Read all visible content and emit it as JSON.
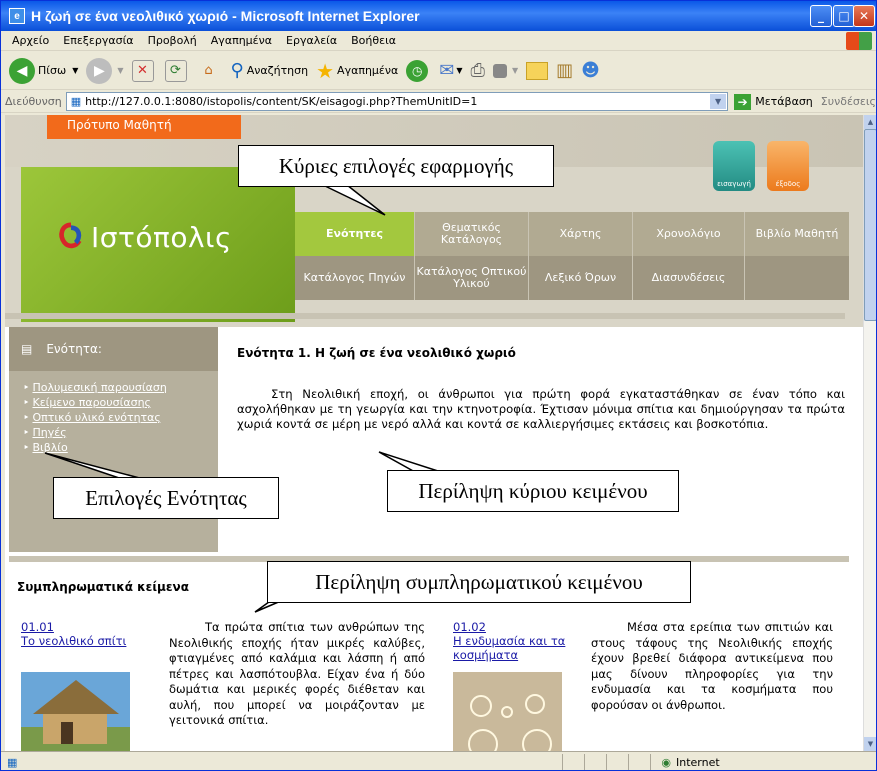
{
  "window": {
    "title": "Η ζωή σε ένα νεολιθικό χωριό - Microsoft Internet Explorer"
  },
  "menu": [
    "Αρχείο",
    "Επεξεργασία",
    "Προβολή",
    "Αγαπημένα",
    "Εργαλεία",
    "Βοήθεια"
  ],
  "toolbar": {
    "back": "Πίσω",
    "search": "Αναζήτηση",
    "favorites": "Αγαπημένα"
  },
  "address": {
    "label": "Διεύθυνση",
    "url": "http://127.0.0.1:8080/istopolis/content/SK/eisagogi.php?ThemUnitID=1",
    "go": "Μετάβαση",
    "links": "Συνδέσεις"
  },
  "site": {
    "model_tab": "Πρότυπο Μαθητή",
    "logo": "Ιστόπολις",
    "icons": [
      {
        "label": "εισαγωγή",
        "color": "#2fa39a"
      },
      {
        "label": "έξοδος",
        "color": "#f08a2a"
      }
    ],
    "nav_row1": [
      "Ενότητες",
      "Θεματικός Κατάλογος",
      "Χάρτης",
      "Χρονολόγιο",
      "Βιβλίο Μαθητή"
    ],
    "nav_row2": [
      "Κατάλογος Πηγών",
      "Κατάλογος Οπτικού Υλικού",
      "Λεξικό Όρων",
      "Διασυνδέσεις"
    ]
  },
  "sidebar": {
    "heading": "Ενότητα:",
    "items": [
      "Πολυμεσική παρουσίαση",
      "Κείμενο παρουσίασης",
      "Οπτικό υλικό ενότητας",
      "Πηγές",
      "Βιβλίο"
    ]
  },
  "main": {
    "title": "Ενότητα 1. Η ζωή σε ένα νεολιθικό χωριό",
    "paragraph": "Στη Νεολιθική εποχή, οι άνθρωποι για πρώτη φορά εγκαταστάθηκαν σε έναν τόπο και ασχολήθηκαν με τη γεωργία και την κτηνοτροφία. Έχτισαν μόνιμα σπίτια και δημιούργησαν τα πρώτα χωριά κοντά σε μέρη με νερό αλλά και κοντά σε καλλιεργήσιμες εκτάσεις και βοσκοτόπια."
  },
  "supplementary": {
    "heading": "Συμπληρωματικά κείμενα",
    "cards": [
      {
        "num": "01.01",
        "link": "Το νεολιθικό σπίτι",
        "text": "Τα πρώτα σπίτια των ανθρώπων της Νεολιθικής εποχής ήταν μικρές καλύβες, φτιαγμένες από καλάμια και λάσπη ή από πέτρες και λασπότουβλα. Είχαν ένα ή δύο δωμάτια και μερικές φορές διέθεταν και αυλή, που μπορεί να μοιράζονταν με γειτονικά σπίτια."
      },
      {
        "num": "01.02",
        "link": "Η ενδυμασία και τα κοσμήματα",
        "text": "Μέσα στα ερείπια των σπιτιών και στους τάφους της Νεολιθικής εποχής έχουν βρεθεί διάφορα αντικείμενα που μας δίνουν πληροφορίες για την ενδυμασία και τα κοσμήματα που φορούσαν οι άνθρωποι."
      }
    ]
  },
  "callouts": {
    "main_options": "Κύριες επιλογές εφαρμογής",
    "unit_options": "Επιλογές Ενότητας",
    "main_summary": "Περίληψη κύριου κειμένου",
    "sup_summary": "Περίληψη συμπληρωματικού κειμένου"
  },
  "status": {
    "zone": "Internet"
  }
}
